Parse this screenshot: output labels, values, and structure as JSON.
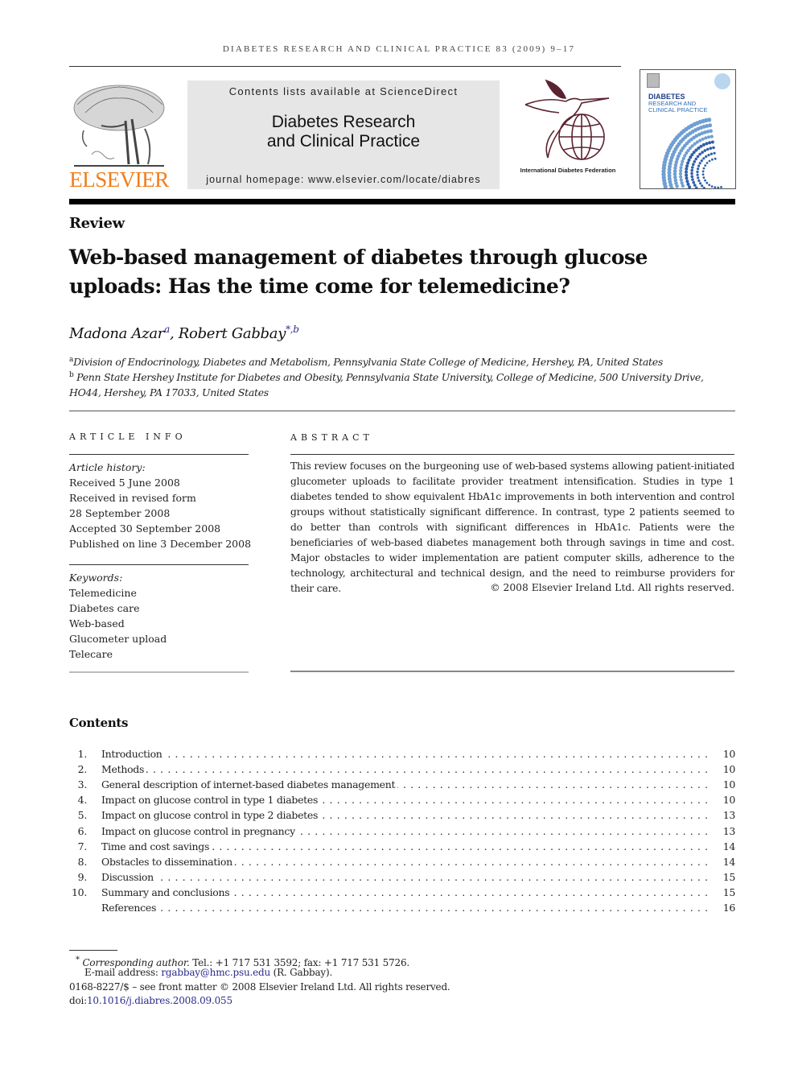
{
  "header": {
    "running_head": "DIABETES RESEARCH AND CLINICAL PRACTICE 83 (2009) 9–17",
    "publisher": "ELSEVIER",
    "contents_available": "Contents lists available at ScienceDirect",
    "journal_title_line1": "Diabetes Research",
    "journal_title_line2": "and Clinical Practice",
    "journal_homepage": "journal homepage: www.elsevier.com/locate/diabres",
    "idf_label": "International Diabetes Federation",
    "cover": {
      "title_line1": "DIABETES",
      "title_line2": "RESEARCH AND",
      "title_line3": "CLINICAL PRACTICE"
    },
    "colors": {
      "elsevier_orange": "#f07d1a",
      "idf_maroon": "#5a2330",
      "link_blue": "#2b2b8c",
      "cover_blue": "#2e6fb8"
    }
  },
  "article": {
    "section_label": "Review",
    "title_line1": "Web-based management of diabetes through glucose",
    "title_line2": "uploads: Has the time come for telemedicine?",
    "authors": [
      {
        "name": "Madona Azar",
        "sup": "a"
      },
      {
        "name": "Robert Gabbay",
        "sup": "*,b"
      }
    ],
    "affiliations": [
      {
        "mark": "a",
        "text": "Division of Endocrinology, Diabetes and Metabolism, Pennsylvania State College of Medicine, Hershey, PA, United States"
      },
      {
        "mark": "b",
        "text": "Penn State Hershey Institute for Diabetes and Obesity, Pennsylvania State University, College of Medicine, 500 University Drive,",
        "text_cont": "HO44, Hershey, PA 17033, United States"
      }
    ]
  },
  "article_info": {
    "heading": "ARTICLE INFO",
    "history_label": "Article history:",
    "history": [
      "Received 5 June 2008",
      "Received in revised form",
      "28 September 2008",
      "Accepted 30 September 2008",
      "Published on line 3 December 2008"
    ],
    "keywords_label": "Keywords:",
    "keywords": [
      "Telemedicine",
      "Diabetes care",
      "Web-based",
      "Glucometer upload",
      "Telecare"
    ]
  },
  "abstract": {
    "heading": "ABSTRACT",
    "text": "This review focuses on the burgeoning use of web-based systems allowing patient-initiated glucometer uploads to facilitate provider treatment intensification. Studies in type 1 diabetes tended to show equivalent HbA1c improvements in both intervention and control groups without statistically significant difference. In contrast, type 2 patients seemed to do better than controls with significant differences in HbA1c. Patients were the beneficiaries of web-based diabetes management both through savings in time and cost. Major obstacles to wider implementation are patient computer skills, adherence to the technology, architectural and technical design, and the need to reimburse providers for their care.",
    "copyright": "© 2008 Elsevier Ireland Ltd. All rights reserved."
  },
  "contents": {
    "heading": "Contents",
    "items": [
      {
        "num": "1.",
        "label": "Introduction",
        "page": "10"
      },
      {
        "num": "2.",
        "label": "Methods",
        "page": "10"
      },
      {
        "num": "3.",
        "label": "General description of internet-based diabetes management",
        "page": "10"
      },
      {
        "num": "4.",
        "label": "Impact on glucose control in type 1 diabetes",
        "page": "10"
      },
      {
        "num": "5.",
        "label": "Impact on glucose control in type 2 diabetes",
        "page": "13"
      },
      {
        "num": "6.",
        "label": "Impact on glucose control in pregnancy",
        "page": "13"
      },
      {
        "num": "7.",
        "label": "Time and cost savings",
        "page": "14"
      },
      {
        "num": "8.",
        "label": "Obstacles to dissemination",
        "page": "14"
      },
      {
        "num": "9.",
        "label": "Discussion",
        "page": "15"
      },
      {
        "num": "10.",
        "label": "Summary and conclusions",
        "page": "15"
      },
      {
        "num": "",
        "label": "References",
        "page": "16"
      }
    ]
  },
  "footnotes": {
    "corresponding_mark": "*",
    "corresponding_label": "Corresponding author.",
    "corresponding_contact": " Tel.: +1 717 531 3592; fax: +1 717 531 5726.",
    "email_label": "E-mail address: ",
    "email": "rgabbay@hmc.psu.edu",
    "email_suffix": " (R. Gabbay).",
    "front_matter": "0168-8227/$ – see front matter © 2008 Elsevier Ireland Ltd. All rights reserved.",
    "doi_prefix": "doi:",
    "doi": "10.1016/j.diabres.2008.09.055"
  }
}
